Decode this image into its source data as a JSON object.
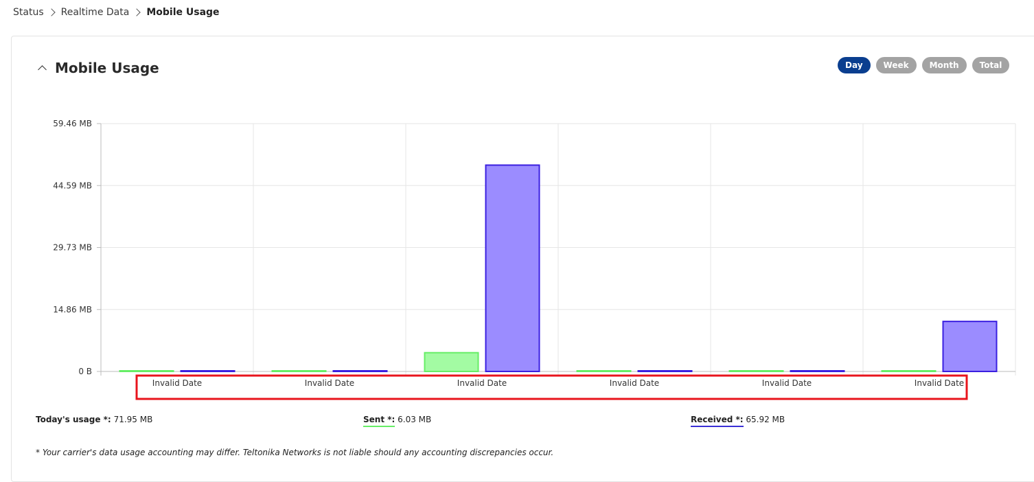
{
  "breadcrumb": {
    "items": [
      "Status",
      "Realtime Data",
      "Mobile Usage"
    ]
  },
  "section": {
    "title": "Mobile Usage"
  },
  "period_buttons": {
    "day": "Day",
    "week": "Week",
    "month": "Month",
    "total": "Total",
    "active": "Day"
  },
  "chart_data": {
    "type": "bar",
    "categories": [
      "Invalid Date",
      "Invalid Date",
      "Invalid Date",
      "Invalid Date",
      "Invalid Date",
      "Invalid Date"
    ],
    "series": [
      {
        "name": "Sent",
        "values": [
          0,
          0,
          4.5,
          0,
          0,
          0
        ],
        "fill": "#a3fba3",
        "stroke": "#66ee66"
      },
      {
        "name": "Received",
        "values": [
          0.1,
          0.1,
          49.5,
          0.1,
          0.1,
          12.0
        ],
        "fill": "#9b8cff",
        "stroke": "#3a1fe0"
      }
    ],
    "yticks": [
      "0 B",
      "14.86 MB",
      "29.73 MB",
      "44.59 MB",
      "59.46 MB"
    ],
    "ylim": [
      0,
      59.46
    ],
    "grid": true
  },
  "summary": {
    "today_label": "Today's usage *:",
    "today_value": "71.95 MB",
    "sent_label": "Sent *:",
    "sent_value": "6.03 MB",
    "received_label": "Received *:",
    "received_value": "65.92 MB"
  },
  "footnote": "* Your carrier's data usage accounting may differ. Teltonika Networks is not liable should any accounting discrepancies occur.",
  "colors": {
    "sent_line": "#66ee66",
    "received_line": "#3a2fd6",
    "active_button": "#0a3e8f",
    "inactive_button": "#a3a3a3",
    "highlight_box": "#e8141c"
  }
}
